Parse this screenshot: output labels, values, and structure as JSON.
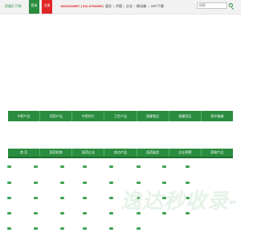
{
  "topbar": {
    "site_name": "药福天下网!",
    "login_label": "登录",
    "register_label": "注册",
    "hotline": "18616208997 | 010-87983933",
    "links": [
      "留言",
      "代理",
      "企业",
      "移动端",
      "APP下载"
    ],
    "search_placeholder": "搜索"
  },
  "categories": [
    "中药产品",
    "西药产品",
    "中药饮片",
    "卫生产品",
    "保健食品",
    "保健用品",
    "医疗器械"
  ],
  "nav": [
    "首 页",
    "医药招商",
    "医药企业",
    "热点产品",
    "医药展会",
    "企业招聘",
    "药助产品"
  ],
  "watermark": "逸达秒收录-智",
  "colors": {
    "primary": "#2a8c3f",
    "accent": "#e12626"
  }
}
